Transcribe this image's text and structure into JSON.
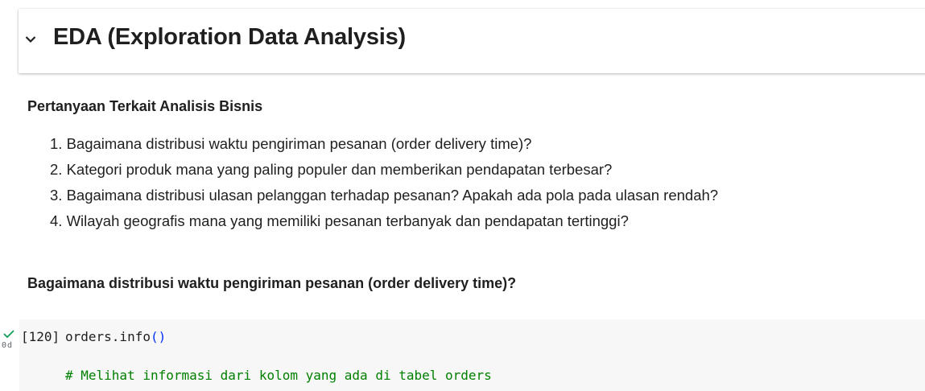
{
  "section": {
    "title": "EDA (Exploration Data Analysis)",
    "toggle_icon": "chevron-down-icon"
  },
  "markdown": {
    "heading": "Pertanyaan Terkait Analisis Bisnis",
    "questions": [
      "1. Bagaimana distribusi waktu pengiriman pesanan (order delivery time)?",
      "2. Kategori produk mana yang paling populer dan memberikan pendapatan terbesar?",
      "3. Bagaimana distribusi ulasan pelanggan terhadap pesanan? Apakah ada pola pada ulasan rendah?",
      "4. Wilayah geografis mana yang memiliki pesanan terbanyak dan pendapatan tertinggi?"
    ],
    "subheading": "Bagaimana distribusi waktu pengiriman pesanan (order delivery time)?"
  },
  "code_cell": {
    "status_icon": "checkmark-icon",
    "exec_time": "0d",
    "exec_count": "[120]",
    "line1_code": "orders.info",
    "line1_parens": "()",
    "line2_comment": "# Melihat informasi dari kolom yang ada di tabel orders"
  },
  "colors": {
    "check": "#0f9d58",
    "comment": "#008000",
    "paren": "#0431fa",
    "cell_bg": "#f7f7f7"
  }
}
